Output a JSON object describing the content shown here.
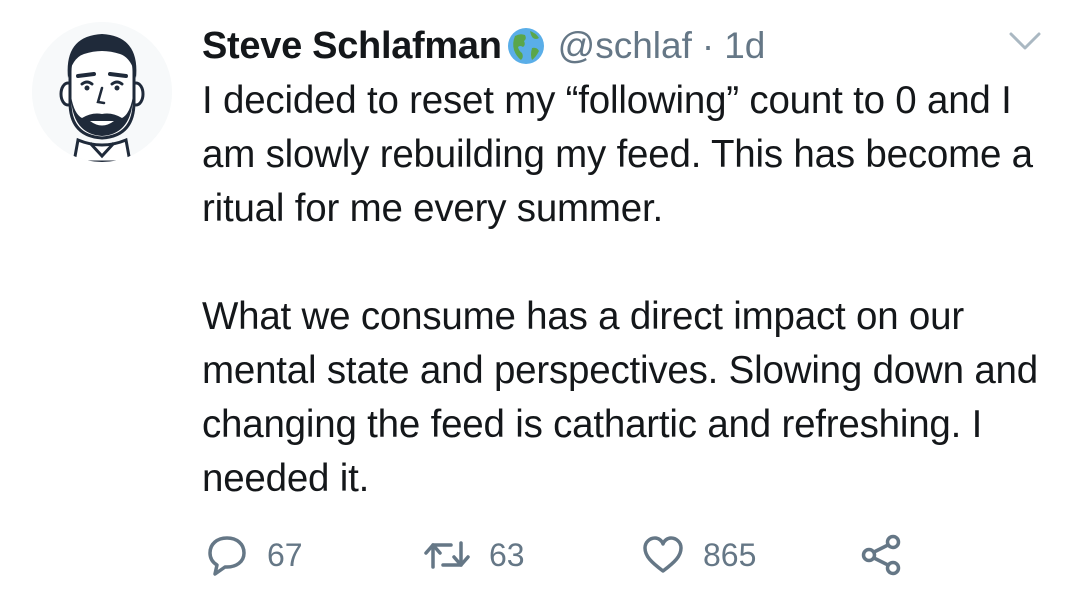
{
  "tweet": {
    "display_name": "Steve Schlafman",
    "name_badge_icon": "globe-americas-icon",
    "handle": "@schlaf",
    "separator": "·",
    "time": "1d",
    "body_paragraph_1": "I decided to reset my “following” count to 0 and I am slowly rebuilding my feed. This has become a ritual for me every summer.",
    "body_paragraph_2": "What we consume has a direct impact on our mental state and perspectives. Slowing down and changing the feed is cathartic and refreshing. I needed it.",
    "menu_icon": "chevron-down-icon"
  },
  "actions": {
    "reply": {
      "icon": "reply-bubble-icon",
      "count": "67"
    },
    "retweet": {
      "icon": "retweet-icon",
      "count": "63"
    },
    "like": {
      "icon": "heart-icon",
      "count": "865"
    },
    "share": {
      "icon": "share-icon"
    }
  },
  "colors": {
    "text_primary": "#14171a",
    "text_secondary": "#657786",
    "background": "#ffffff"
  }
}
